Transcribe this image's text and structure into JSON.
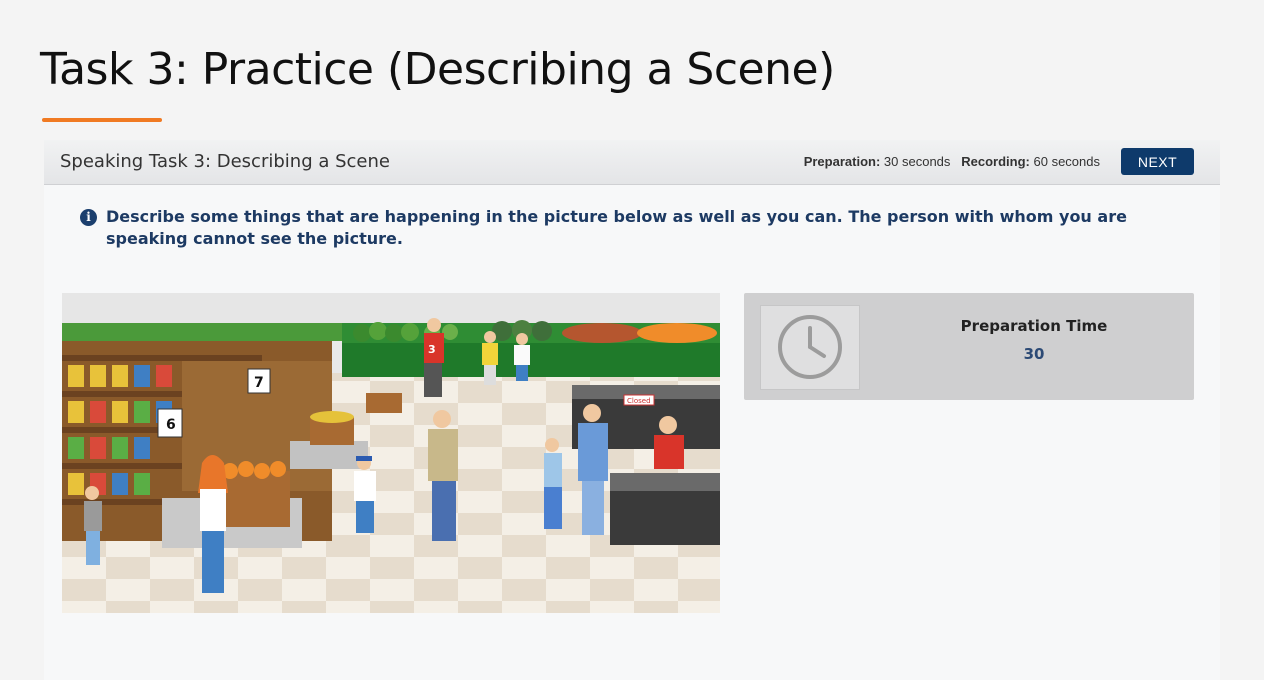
{
  "slide": {
    "title": "Task 3: Practice (Describing a Scene)",
    "accent_color": "#f07a22"
  },
  "header": {
    "title": "Speaking Task 3: Describing a Scene",
    "preparation_label": "Preparation:",
    "preparation_value": "30 seconds",
    "recording_label": "Recording:",
    "recording_value": "60 seconds",
    "next_label": "NEXT",
    "next_color": "#0e3a6b"
  },
  "instructions": {
    "icon": "info-icon",
    "text": "Describe some things that are happening in the picture below as well as you can. The person with whom you are speaking cannot see the picture."
  },
  "scene": {
    "aisle_number_7": "7",
    "aisle_number_6": "6",
    "sign_text": "Closed",
    "shirt_number": "3"
  },
  "timer": {
    "icon": "clock-icon",
    "label": "Preparation Time",
    "value": "30"
  }
}
